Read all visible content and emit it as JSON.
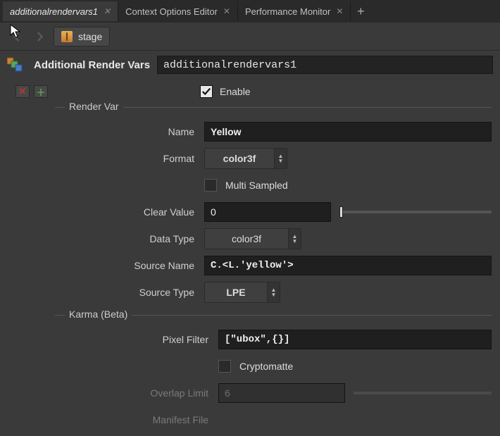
{
  "tabs": {
    "items": [
      {
        "label": "additionalrendervars1",
        "active": true
      },
      {
        "label": "Context Options Editor",
        "active": false
      },
      {
        "label": "Performance Monitor",
        "active": false
      }
    ]
  },
  "path": {
    "text": "stage"
  },
  "header": {
    "title": "Additional Render Vars",
    "name_value": "additionalrendervars1"
  },
  "enable": {
    "label": "Enable",
    "checked": true
  },
  "groups": {
    "render_var": {
      "title": "Render Var"
    },
    "karma": {
      "title": "Karma (Beta)"
    }
  },
  "params": {
    "name": {
      "label": "Name",
      "value": "Yellow"
    },
    "format": {
      "label": "Format",
      "value": "color3f"
    },
    "multi_sampled": {
      "label": "Multi Sampled",
      "checked": false
    },
    "clear_value": {
      "label": "Clear Value",
      "value": "0"
    },
    "data_type": {
      "label": "Data Type",
      "value": "color3f"
    },
    "source_name": {
      "label": "Source Name",
      "value": "C.<L.'yellow'>"
    },
    "source_type": {
      "label": "Source Type",
      "value": "LPE"
    },
    "pixel_filter": {
      "label": "Pixel Filter",
      "value": "[\"ubox\",{}]"
    },
    "cryptomatte": {
      "label": "Cryptomatte",
      "checked": false
    },
    "overlap_limit": {
      "label": "Overlap Limit",
      "value": "6",
      "enabled": false
    },
    "manifest_file": {
      "label": "Manifest File",
      "value": "",
      "enabled": false
    }
  }
}
